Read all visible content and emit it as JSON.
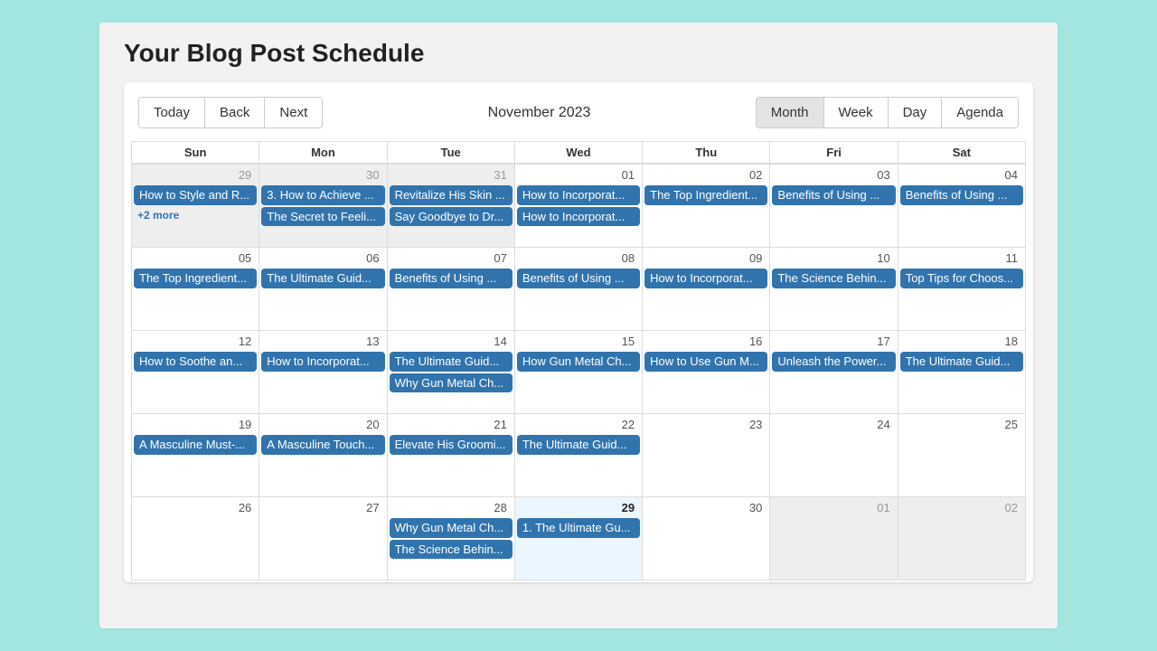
{
  "header": {
    "title": "Your Blog Post Schedule"
  },
  "toolbar": {
    "nav": {
      "today": "Today",
      "back": "Back",
      "next": "Next"
    },
    "label": "November 2023",
    "views": {
      "month": "Month",
      "week": "Week",
      "day": "Day",
      "agenda": "Agenda"
    },
    "active_view": "month"
  },
  "day_headers": [
    "Sun",
    "Mon",
    "Tue",
    "Wed",
    "Thu",
    "Fri",
    "Sat"
  ],
  "weeks": [
    [
      {
        "num": "29",
        "off": true,
        "events": [
          "How to Style and R..."
        ],
        "more": "+2 more"
      },
      {
        "num": "30",
        "off": true,
        "events": [
          "3. How to Achieve ...",
          "The Secret to Feeli..."
        ]
      },
      {
        "num": "31",
        "off": true,
        "events": [
          "Revitalize His Skin ...",
          "Say Goodbye to Dr..."
        ]
      },
      {
        "num": "01",
        "events": [
          "How to Incorporat...",
          "How to Incorporat..."
        ]
      },
      {
        "num": "02",
        "events": [
          "The Top Ingredient..."
        ]
      },
      {
        "num": "03",
        "events": [
          "Benefits of Using ..."
        ]
      },
      {
        "num": "04",
        "events": [
          "Benefits of Using ..."
        ]
      }
    ],
    [
      {
        "num": "05",
        "events": [
          "The Top Ingredient..."
        ]
      },
      {
        "num": "06",
        "events": [
          "The Ultimate Guid..."
        ]
      },
      {
        "num": "07",
        "events": [
          "Benefits of Using ..."
        ]
      },
      {
        "num": "08",
        "events": [
          "Benefits of Using ..."
        ]
      },
      {
        "num": "09",
        "events": [
          "How to Incorporat..."
        ]
      },
      {
        "num": "10",
        "events": [
          "The Science Behin..."
        ]
      },
      {
        "num": "11",
        "events": [
          "Top Tips for Choos..."
        ]
      }
    ],
    [
      {
        "num": "12",
        "events": [
          "How to Soothe an..."
        ]
      },
      {
        "num": "13",
        "events": [
          "How to Incorporat..."
        ]
      },
      {
        "num": "14",
        "events": [
          "The Ultimate Guid...",
          "Why Gun Metal Ch..."
        ]
      },
      {
        "num": "15",
        "events": [
          "How Gun Metal Ch..."
        ]
      },
      {
        "num": "16",
        "events": [
          "How to Use Gun M..."
        ]
      },
      {
        "num": "17",
        "events": [
          "Unleash the Power..."
        ]
      },
      {
        "num": "18",
        "events": [
          "The Ultimate Guid..."
        ]
      }
    ],
    [
      {
        "num": "19",
        "events": [
          "A Masculine Must-..."
        ]
      },
      {
        "num": "20",
        "events": [
          "A Masculine Touch..."
        ]
      },
      {
        "num": "21",
        "events": [
          "Elevate His Groomi..."
        ]
      },
      {
        "num": "22",
        "events": [
          "The Ultimate Guid..."
        ]
      },
      {
        "num": "23",
        "events": []
      },
      {
        "num": "24",
        "events": []
      },
      {
        "num": "25",
        "events": []
      }
    ],
    [
      {
        "num": "26",
        "events": []
      },
      {
        "num": "27",
        "events": []
      },
      {
        "num": "28",
        "events": [
          "Why Gun Metal Ch...",
          "The Science Behin..."
        ]
      },
      {
        "num": "29",
        "today": true,
        "events": [
          "1. The Ultimate Gu..."
        ]
      },
      {
        "num": "30",
        "events": []
      },
      {
        "num": "01",
        "off": true,
        "events": []
      },
      {
        "num": "02",
        "off": true,
        "events": []
      }
    ]
  ]
}
